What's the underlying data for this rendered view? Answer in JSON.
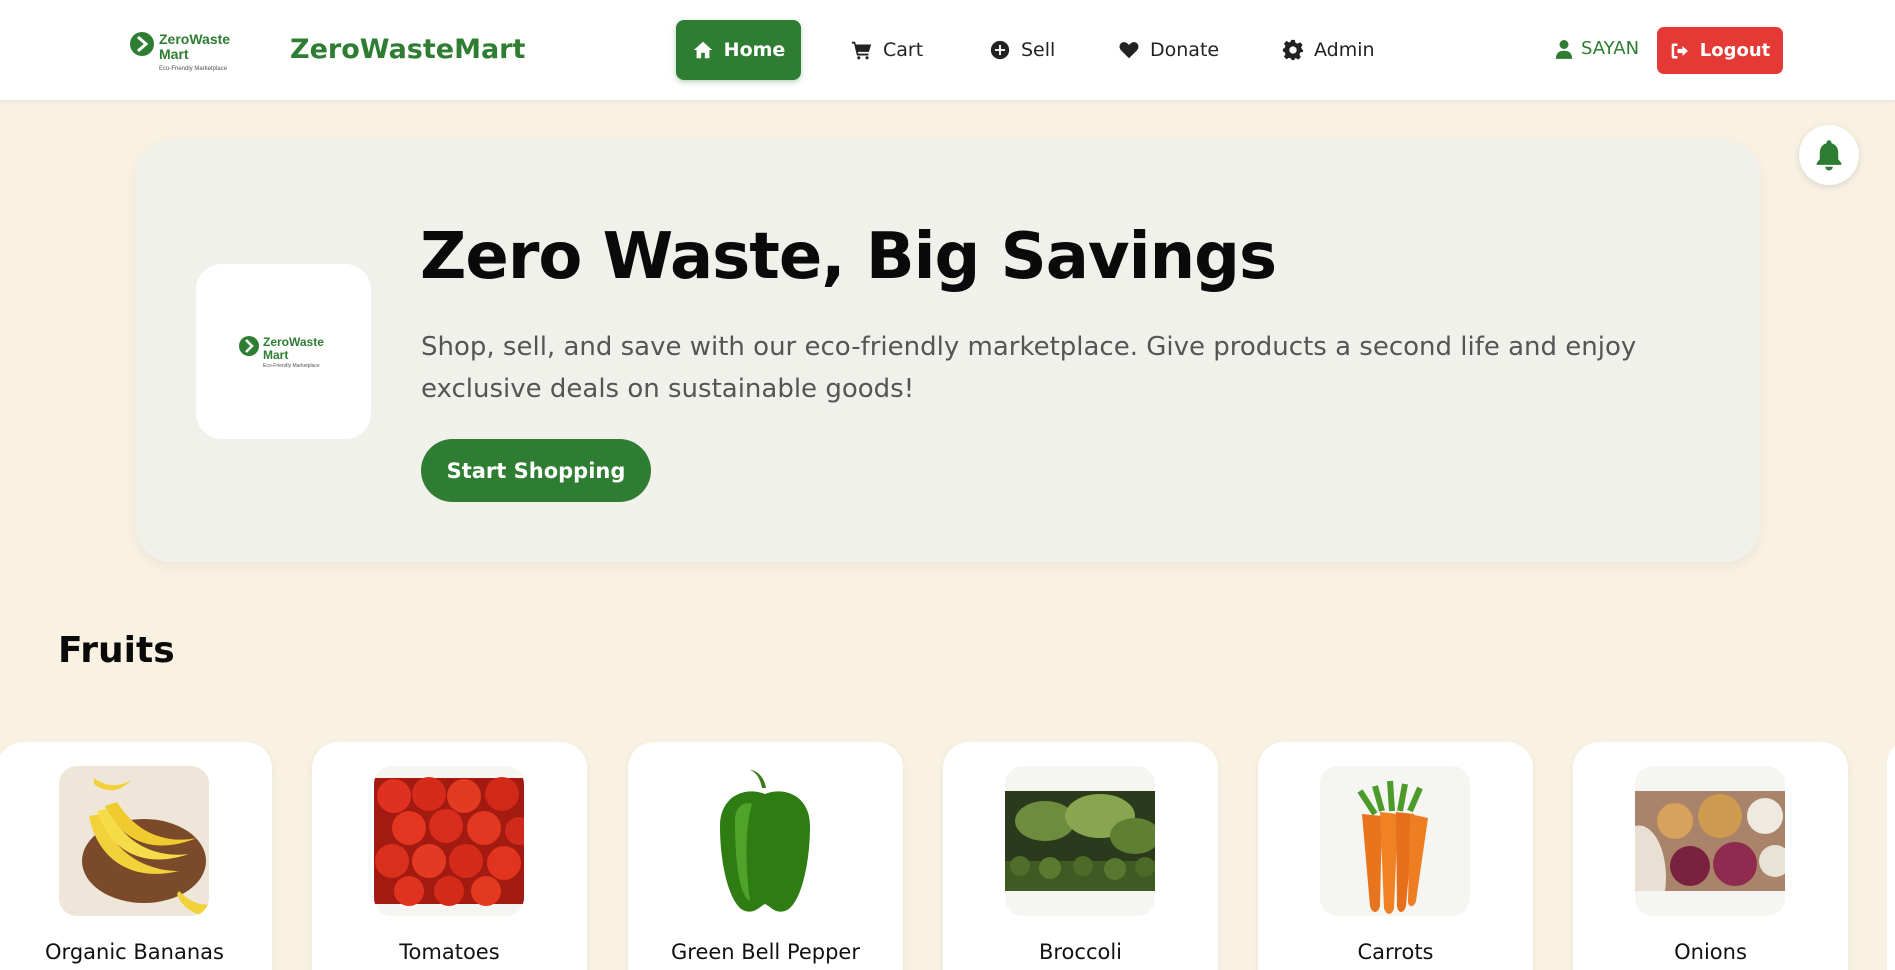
{
  "navbar": {
    "logo_text_line1": "ZeroWaste",
    "logo_text_line2": "Mart",
    "logo_tagline": "Eco-Friendly Marketplace",
    "brand": "ZeroWasteMart",
    "items": [
      {
        "label": "Home",
        "icon": "home-icon",
        "active": true
      },
      {
        "label": "Cart",
        "icon": "cart-icon"
      },
      {
        "label": "Sell",
        "icon": "plus-circle-icon"
      },
      {
        "label": "Donate",
        "icon": "heart-icon"
      },
      {
        "label": "Admin",
        "icon": "gear-icon"
      }
    ],
    "user": "SAYAN",
    "logout": "Logout"
  },
  "hero": {
    "title": "Zero Waste, Big Savings",
    "subtitle": "Shop, sell, and save with our eco-friendly marketplace. Give products a second life and enjoy exclusive deals on sustainable goods!",
    "button": "Start Shopping",
    "logo_text_line1": "ZeroWaste",
    "logo_text_line2": "Mart",
    "logo_tagline": "Eco-Friendly Marketplace"
  },
  "section": {
    "title": "Fruits",
    "products": [
      {
        "name": "Organic Bananas"
      },
      {
        "name": "Tomatoes"
      },
      {
        "name": "Green Bell Pepper"
      },
      {
        "name": "Broccoli"
      },
      {
        "name": "Carrots"
      },
      {
        "name": "Onions"
      }
    ]
  },
  "colors": {
    "accent": "#2e7d32",
    "logout": "#e53935",
    "background": "#f9f2e3"
  }
}
